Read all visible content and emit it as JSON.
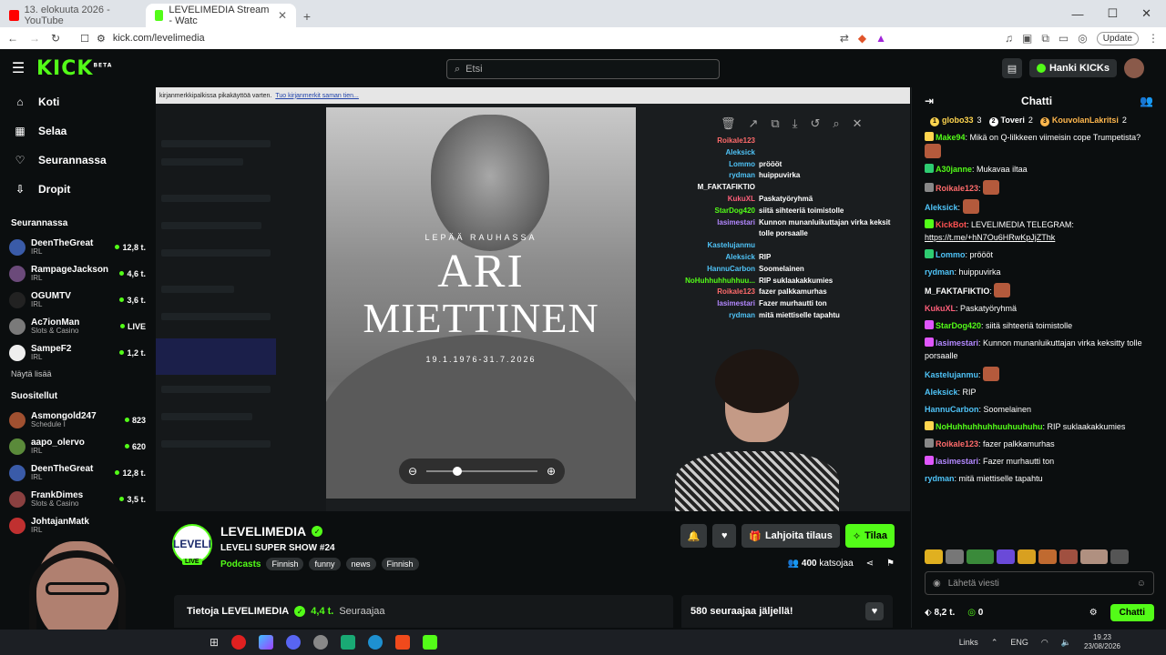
{
  "browser": {
    "tabs": [
      {
        "label": "13. elokuuta 2026 - YouTube",
        "active": false
      },
      {
        "label": "LEVELIMEDIA Stream - Watc",
        "active": true
      }
    ],
    "url": "kick.com/levelimedia",
    "update_label": "Update"
  },
  "topnav": {
    "logo": "KICK",
    "logo_sup": "BETA",
    "search_placeholder": "Etsi",
    "get_kicks": "Hanki KICKs"
  },
  "sidebar": {
    "nav": [
      {
        "label": "Koti",
        "icon": "home-icon"
      },
      {
        "label": "Selaa",
        "icon": "browse-icon"
      },
      {
        "label": "Seurannassa",
        "icon": "heart-icon"
      },
      {
        "label": "Dropit",
        "icon": "drops-icon"
      }
    ],
    "following_header": "Seurannassa",
    "following": [
      {
        "name": "DeenTheGreat",
        "cat": "IRL",
        "viewers": "12,8 t.",
        "color": "#3a5ba8"
      },
      {
        "name": "RampageJackson",
        "cat": "IRL",
        "viewers": "4,6 t.",
        "color": "#6b4a7a"
      },
      {
        "name": "OGUMTV",
        "cat": "IRL",
        "viewers": "3,6 t.",
        "color": "#222"
      },
      {
        "name": "Ac7ionMan",
        "cat": "Slots & Casino",
        "viewers": "LIVE",
        "color": "#7a7a7a"
      },
      {
        "name": "SampeF2",
        "cat": "IRL",
        "viewers": "1,2 t.",
        "color": "#eee"
      }
    ],
    "show_more": "Näytä lisää",
    "recommended_header": "Suositellut",
    "recommended": [
      {
        "name": "Asmongold247",
        "cat": "Schedule I",
        "viewers": "823",
        "color": "#a05030"
      },
      {
        "name": "aapo_olervo",
        "cat": "IRL",
        "viewers": "620",
        "color": "#5a8a3a"
      },
      {
        "name": "DeenTheGreat",
        "cat": "IRL",
        "viewers": "12,8 t.",
        "color": "#3a5ba8"
      },
      {
        "name": "FrankDimes",
        "cat": "Slots & Casino",
        "viewers": "3,5 t.",
        "color": "#8a4040"
      },
      {
        "name": "JohtajanMatk",
        "cat": "IRL",
        "viewers": "",
        "color": "#c03030"
      }
    ]
  },
  "player": {
    "notice": "kirjanmerkkipalkissa pikakäyttöä varten.",
    "notice_link": "Tuo kirjanmerkit saman tien...",
    "memorial_sub": "LEPÄÄ RAUHASSA",
    "memorial_first": "ARI",
    "memorial_last": "MIETTINEN",
    "memorial_dates": "19.1.1976-31.7.2026",
    "overlay_chat": [
      {
        "user": "Roikale123",
        "msg": "",
        "color": "#ff6b6b"
      },
      {
        "user": "Aleksick",
        "msg": "",
        "color": "#4fc3f7"
      },
      {
        "user": "Lommo",
        "msg": "pröööt",
        "color": "#4fc3f7"
      },
      {
        "user": "rydman",
        "msg": "huippuvirka",
        "color": "#4fc3f7"
      },
      {
        "user": "M_FAKTAFIKTIO",
        "msg": "",
        "color": "#ffffff"
      },
      {
        "user": "KukuXL",
        "msg": "Paskatyöryhmä",
        "color": "#ff5f7a"
      },
      {
        "user": "StarDog420",
        "msg": "siitä sihteeriä toimistolle",
        "color": "#53fc18"
      },
      {
        "user": "lasimestari",
        "msg": "Kunnon munanluikuttajan virka keksit",
        "color": "#b388ff"
      },
      {
        "user": "",
        "msg": "tolle porsaalle",
        "color": "#ffffff"
      },
      {
        "user": "Kastelujanmu",
        "msg": "",
        "color": "#4fc3f7"
      },
      {
        "user": "Aleksick",
        "msg": "RIP",
        "color": "#4fc3f7"
      },
      {
        "user": "HannuCarbon",
        "msg": "Soomelainen",
        "color": "#4fc3f7"
      },
      {
        "user": "NoHuhhuhhuhhuu...",
        "msg": "RIP suklaakakkumies",
        "color": "#53fc18"
      },
      {
        "user": "Roikale123",
        "msg": "fazer palkkamurhas",
        "color": "#ff6b6b"
      },
      {
        "user": "lasimestari",
        "msg": "Fazer murhautti ton",
        "color": "#b388ff"
      },
      {
        "user": "rydman",
        "msg": "mitä miettiselle tapahtu",
        "color": "#4fc3f7"
      }
    ]
  },
  "channel": {
    "avatar_text": "LEVELI",
    "live_label": "LIVE",
    "name": "LEVELIMEDIA",
    "title": "LEVELI SUPER SHOW #24",
    "category": "Podcasts",
    "tags": [
      "Finnish",
      "funny",
      "news",
      "Finnish"
    ],
    "gift_label": "Lahjoita tilaus",
    "subscribe_label": "Tilaa",
    "viewers_count": "400",
    "viewers_label": "katsojaa",
    "about_prefix": "Tietoja LEVELIMEDIA",
    "followers": "4,4 t.",
    "followers_label": "Seuraajaa",
    "goal": "580 seuraajaa jäljellä!"
  },
  "chat": {
    "title": "Chatti",
    "top": [
      {
        "rank": "1",
        "name": "globo33",
        "n": "3",
        "color": "#ffd54f"
      },
      {
        "rank": "2",
        "name": "Toveri",
        "n": "2",
        "color": "#ffffff"
      },
      {
        "rank": "3",
        "name": "KouvolanLakritsi",
        "n": "2",
        "color": "#ffb74d"
      }
    ],
    "messages": [
      {
        "user": "Make94",
        "text": "Mikä on Q-lilkkeen viimeisin cope Trumpetista?",
        "color": "#53fc18",
        "emote": true,
        "badge": "#ffd54f"
      },
      {
        "user": "A30janne",
        "text": "Mukavaa iltaa",
        "color": "#53fc18",
        "emote": false,
        "badge": "#2ecc71"
      },
      {
        "user": "Roikale123",
        "text": "",
        "color": "#ff6b6b",
        "emote": true,
        "badge": "#888888"
      },
      {
        "user": "Aleksick",
        "text": "",
        "color": "#4fc3f7",
        "emote": true,
        "badge": ""
      },
      {
        "user": "KickBot",
        "text": "LEVELIMEDIA TELEGRAM:",
        "link": "https://t.me/+hN7Ou6HRwKpJjZThk",
        "color": "#ff5252",
        "emote": false,
        "badge": "#53fc18"
      },
      {
        "user": "Lommo",
        "text": "pröööt",
        "color": "#4fc3f7",
        "emote": false,
        "badge": "#2ecc71"
      },
      {
        "user": "rydman",
        "text": "huippuvirka",
        "color": "#4fc3f7",
        "emote": false,
        "badge": ""
      },
      {
        "user": "M_FAKTAFIKTIO",
        "text": "",
        "color": "#ffffff",
        "emote": true,
        "badge": ""
      },
      {
        "user": "KukuXL",
        "text": "Paskatyöryhmä",
        "color": "#ff5f7a",
        "emote": false,
        "badge": ""
      },
      {
        "user": "StarDog420",
        "text": "siitä sihteeriä toimistolle",
        "color": "#53fc18",
        "emote": false,
        "badge": "#e056fd"
      },
      {
        "user": "lasimestari",
        "text": "Kunnon munanluikuttajan virka keksitty tolle porsaalle",
        "color": "#b388ff",
        "emote": false,
        "badge": "#e056fd"
      },
      {
        "user": "Kastelujanmu",
        "text": "",
        "color": "#4fc3f7",
        "emote": true,
        "badge": ""
      },
      {
        "user": "Aleksick",
        "text": "RIP",
        "color": "#4fc3f7",
        "emote": false,
        "badge": ""
      },
      {
        "user": "HannuCarbon",
        "text": "Soomelainen",
        "color": "#4fc3f7",
        "emote": false,
        "badge": ""
      },
      {
        "user": "NoHuhhuhhuhhuuhuuhuhu",
        "text": "RIP suklaakakkumies",
        "color": "#53fc18",
        "emote": false,
        "badge": "#ffd54f"
      },
      {
        "user": "Roikale123",
        "text": "fazer palkkamurhas",
        "color": "#ff6b6b",
        "emote": false,
        "badge": "#888888"
      },
      {
        "user": "lasimestari",
        "text": "Fazer murhautti ton",
        "color": "#b388ff",
        "emote": false,
        "badge": "#e056fd"
      },
      {
        "user": "rydman",
        "text": "mitä miettiselle tapahtu",
        "color": "#4fc3f7",
        "emote": false,
        "badge": ""
      }
    ],
    "input_placeholder": "Lähetä viesti",
    "kicks": "8,2 t.",
    "points": "0",
    "send_label": "Chatti"
  },
  "taskbar": {
    "links": "Links",
    "lang": "ENG",
    "time": "19.23",
    "date": "23/08/2026"
  }
}
